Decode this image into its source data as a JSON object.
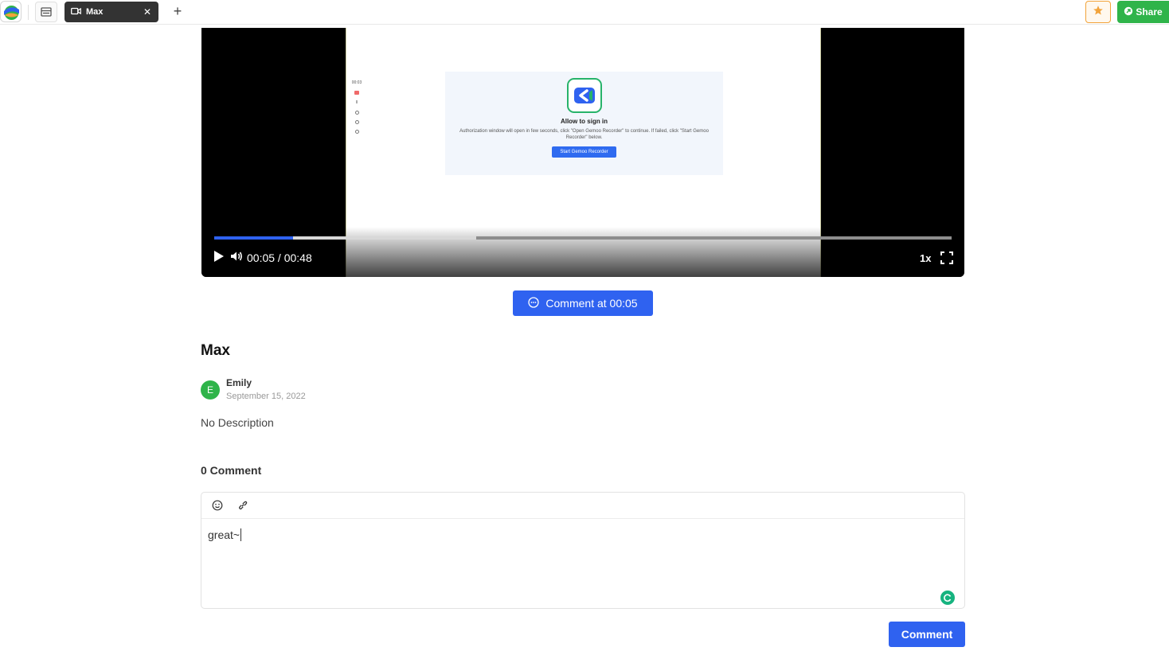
{
  "topbar": {
    "tab_title": "Max",
    "tab_close": "✕",
    "new_tab": "+",
    "share_label": "Share",
    "colors": {
      "accent": "#2f62f0",
      "share": "#2fb44a",
      "star": "#f2a33a"
    }
  },
  "video": {
    "time": "00:05 / 00:48",
    "speed": "1x",
    "played_fraction": 0.107,
    "buffered_fraction": 0.355,
    "frame": {
      "recorder_time": "00:03",
      "title": "Allow to sign in",
      "text": "Authorization window will open in few seconds, click \"Open Gemoo Recorder\" to continue. If failed, click \"Start Gemoo Recorder\" below.",
      "button": "Start Gemoo Recorder"
    }
  },
  "comment_at_label": "Comment at 00:05",
  "post": {
    "title": "Max",
    "author_initial": "E",
    "author": "Emily",
    "date": "September 15, 2022",
    "description": "No Description"
  },
  "comments": {
    "count_label": "0 Comment",
    "draft": "great~",
    "submit_label": "Comment"
  }
}
